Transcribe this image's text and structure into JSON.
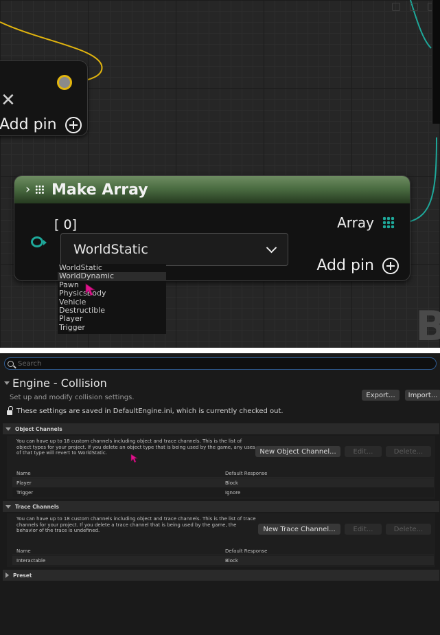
{
  "graph": {
    "node_add_pin": {
      "add_pin_label": "Add pin"
    },
    "make_array": {
      "title": "Make Array",
      "index_label": "[ 0]",
      "selected_value": "WorldStatic",
      "output_label": "Array",
      "add_pin_label": "Add pin"
    },
    "dropdown_options": [
      "WorldStatic",
      "WorldDynamic",
      "Pawn",
      "PhysicsBody",
      "Vehicle",
      "Destructible",
      "Player",
      "Trigger"
    ],
    "corner_glyph": "B",
    "colors": {
      "exec_wire": "#e2b50e",
      "array_pin": "#1ea89a",
      "node_header": "#4b6d42",
      "cursor": "#e0138c"
    }
  },
  "settings": {
    "search_placeholder": "Search",
    "section_title": "Engine - Collision",
    "section_description": "Set up and modify collision settings.",
    "export_label": "Export...",
    "import_label": "Import...",
    "notice": "These settings are saved in DefaultEngine.ini, which is currently checked out.",
    "object_channels": {
      "header": "Object Channels",
      "description": "You can have up to 18 custom channels including object and trace channels. This is the list of object types for your project. If you delete an object type that is being used by the game, any uses of that type will revert to WorldStatic.",
      "new_button": "New Object Channel...",
      "edit_button": "Edit...",
      "delete_button": "Delete...",
      "columns": [
        "Name",
        "Default Response"
      ],
      "rows": [
        {
          "name": "Player",
          "response": "Block"
        },
        {
          "name": "Trigger",
          "response": "Ignore"
        }
      ]
    },
    "trace_channels": {
      "header": "Trace Channels",
      "description": "You can have up to 18 custom channels including object and trace channels. This is the list of trace channels for your project. If you delete a trace channel that is being used by the game, the behavior of the trace is undefined.",
      "new_button": "New Trace Channel...",
      "edit_button": "Edit...",
      "delete_button": "Delete...",
      "columns": [
        "Name",
        "Default Response"
      ],
      "rows": [
        {
          "name": "Interactable",
          "response": "Block"
        }
      ]
    },
    "preset": {
      "header": "Preset"
    }
  }
}
